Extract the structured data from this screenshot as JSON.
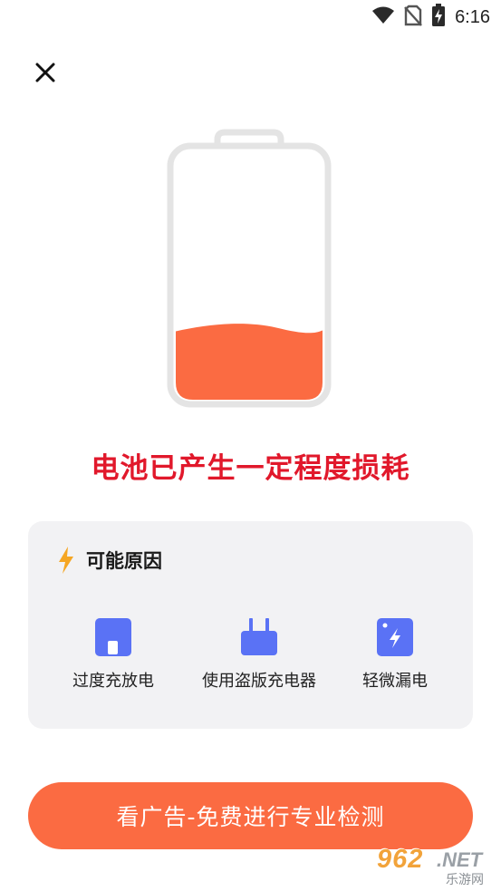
{
  "status_bar": {
    "time": "6:16",
    "icons": [
      "wifi-icon",
      "no-sim-icon",
      "battery-charging-icon"
    ]
  },
  "close_icon": "close-icon",
  "battery": {
    "level_fraction": 0.28,
    "fill_color": "#fb6b42",
    "outline_color": "#e4e4e4"
  },
  "headline": "电池已产生一定程度损耗",
  "reasons": {
    "title": "可能原因",
    "title_icon": "lightning-icon",
    "items": [
      {
        "label": "过度充放电",
        "icon": "battery-box-icon"
      },
      {
        "label": "使用盗版充电器",
        "icon": "charger-icon"
      },
      {
        "label": "轻微漏电",
        "icon": "leak-icon"
      }
    ]
  },
  "cta_label": "看广告-免费进行专业检测",
  "watermark": {
    "number": "962",
    "suffix": ".NET",
    "site": "乐游网"
  },
  "colors": {
    "accent": "#fb6b42",
    "headline": "#e1182b",
    "icon_blue": "#5a72f5",
    "card_bg": "#f2f2f4"
  }
}
